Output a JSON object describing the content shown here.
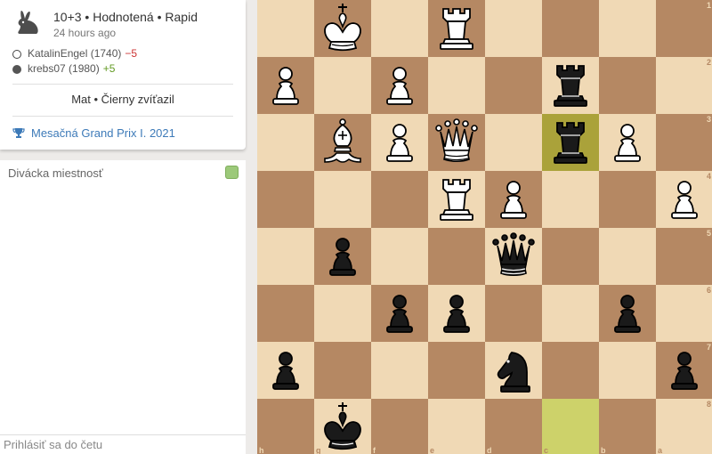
{
  "game": {
    "setup": "10+3 • Hodnotená • Rapid",
    "time": "24 hours ago",
    "variant_icon": "rabbit-icon",
    "players": [
      {
        "color": "white",
        "name": "KatalinEngel (1740)",
        "rating_change": "−5"
      },
      {
        "color": "black",
        "name": "krebs07 (1980)",
        "rating_change": "+5"
      }
    ],
    "result": "Mat • Čierny zvíťazil",
    "tournament": "Mesačná Grand Prix I. 2021",
    "tournament_icon": "trophy-icon"
  },
  "chat": {
    "title": "Divácka miestnosť",
    "placeholder": "Prihlásiť sa do četu"
  },
  "board": {
    "orientation": "black",
    "colors": {
      "light": "#f0d9b5",
      "dark": "#b58863",
      "last_move_from": "#cdd26a",
      "last_move_to": "#aaa23a"
    },
    "files_label_row": [
      "h",
      "g",
      "f",
      "e",
      "d",
      "c",
      "b",
      "a"
    ],
    "ranks_label_col": [
      "1",
      "2",
      "3",
      "4",
      "5",
      "6",
      "7",
      "8"
    ],
    "highlights": [
      "c3",
      "c8"
    ],
    "pieces": [
      {
        "sq": "g1",
        "color": "w",
        "type": "k"
      },
      {
        "sq": "e1",
        "color": "w",
        "type": "r"
      },
      {
        "sq": "h2",
        "color": "w",
        "type": "p"
      },
      {
        "sq": "f2",
        "color": "w",
        "type": "p"
      },
      {
        "sq": "c2",
        "color": "b",
        "type": "r"
      },
      {
        "sq": "g3",
        "color": "w",
        "type": "b"
      },
      {
        "sq": "f3",
        "color": "w",
        "type": "p"
      },
      {
        "sq": "e3",
        "color": "w",
        "type": "q"
      },
      {
        "sq": "c3",
        "color": "b",
        "type": "r"
      },
      {
        "sq": "b3",
        "color": "w",
        "type": "p"
      },
      {
        "sq": "e4",
        "color": "w",
        "type": "r"
      },
      {
        "sq": "d4",
        "color": "w",
        "type": "p"
      },
      {
        "sq": "a4",
        "color": "w",
        "type": "p"
      },
      {
        "sq": "g5",
        "color": "b",
        "type": "p"
      },
      {
        "sq": "d5",
        "color": "b",
        "type": "q"
      },
      {
        "sq": "f6",
        "color": "b",
        "type": "p"
      },
      {
        "sq": "e6",
        "color": "b",
        "type": "p"
      },
      {
        "sq": "b6",
        "color": "b",
        "type": "p"
      },
      {
        "sq": "h7",
        "color": "b",
        "type": "p"
      },
      {
        "sq": "d7",
        "color": "b",
        "type": "n"
      },
      {
        "sq": "a7",
        "color": "b",
        "type": "p"
      },
      {
        "sq": "g8",
        "color": "b",
        "type": "k"
      }
    ]
  }
}
